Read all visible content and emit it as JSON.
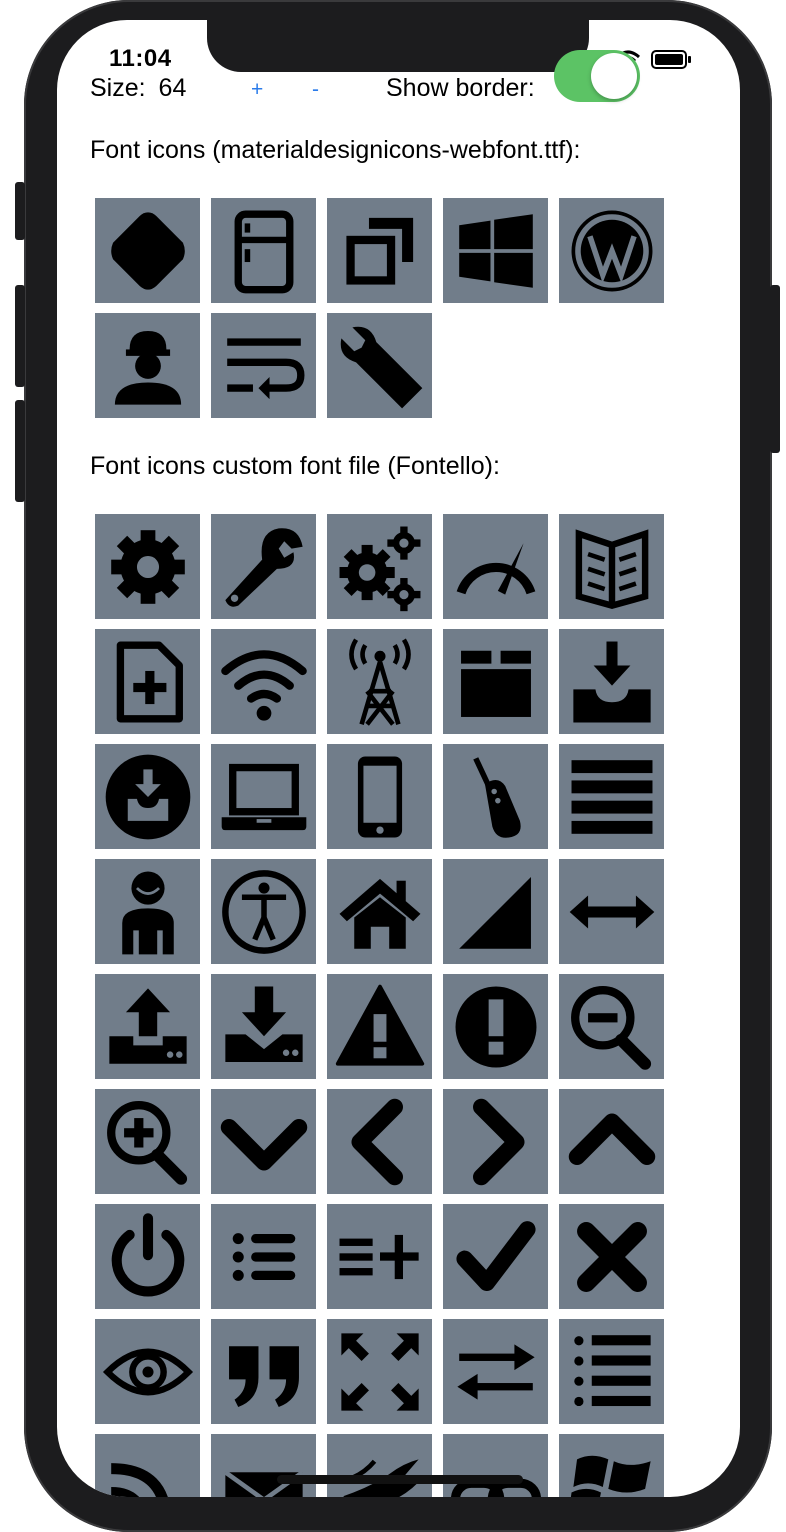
{
  "status": {
    "time": "11:04"
  },
  "controls": {
    "size_label": "Size:",
    "size_value": "64",
    "plus_label": "+",
    "minus_label": "-",
    "border_label": "Show border:",
    "border_on": true
  },
  "sections": {
    "material_title": "Font icons (materialdesignicons-webfont.ttf):",
    "fontello_title": "Font icons custom font file (Fontello):"
  },
  "colors": {
    "tile": "#717d8a",
    "accent": "#2b7bea",
    "toggle_on": "#5cc365"
  },
  "material_icons": [
    "diamond-icon",
    "fridge-icon",
    "window-restore-icon",
    "windows-logo-icon",
    "wordpress-logo-icon",
    "worker-icon",
    "wrap-text-icon",
    "wrench-icon"
  ],
  "fontello_icons": [
    "cog-icon",
    "wrench-icon",
    "cogs-icon",
    "gauge-icon",
    "book-open-icon",
    "file-add-icon",
    "wifi-icon",
    "signal-tower-icon",
    "box-icon",
    "inbox-download-icon",
    "download-circle-icon",
    "laptop-icon",
    "mobile-icon",
    "mouse-icon",
    "menu-icon",
    "user-icon",
    "accessibility-icon",
    "home-icon",
    "signal-triangle-icon",
    "resize-horizontal-icon",
    "upload-icon",
    "download-icon",
    "warning-icon",
    "exclamation-icon",
    "zoom-out-icon",
    "zoom-in-icon",
    "chevron-down-icon",
    "chevron-left-icon",
    "chevron-right-icon",
    "chevron-up-icon",
    "power-icon",
    "list-bullet-icon",
    "list-add-icon",
    "checkmark-icon",
    "close-icon",
    "eye-icon",
    "quote-icon",
    "expand-icon",
    "exchange-icon",
    "list-icon",
    "rss-icon",
    "mail-icon",
    "fire-icon",
    "link-icon",
    "windows-flag-icon"
  ]
}
